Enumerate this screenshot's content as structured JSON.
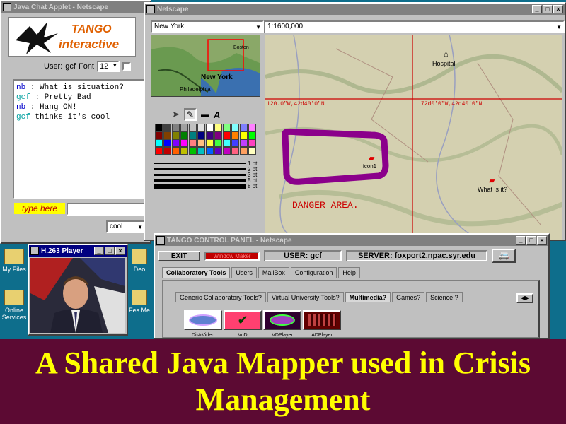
{
  "chat": {
    "title": "Java Chat Applet - Netscape",
    "logo_line1": "TANGO",
    "logo_line2": "interactive",
    "user_label": "User:",
    "user_value": "gcf",
    "font_label": "Font",
    "font_value": "12",
    "messages": [
      {
        "user": "nb",
        "text": ": What is situation?",
        "color": "#0000cc"
      },
      {
        "user": "gcf",
        "text": ": Pretty Bad",
        "color": "#00a0a0"
      },
      {
        "user": "nb",
        "text": ": Hang ON!",
        "color": "#0000cc"
      },
      {
        "user": "gcf",
        "text": "thinks it's cool",
        "color": "#00a0a0"
      }
    ],
    "type_here_label": "type here",
    "mood_value": "cool"
  },
  "netscape": {
    "title": "Netscape",
    "location_value": "New York",
    "scale_value": "1:1600,000",
    "minimap_label": "New York",
    "minimap_label2": "Philadelphia",
    "minimap_label3": "Boston",
    "palette_colors": [
      "#000000",
      "#404040",
      "#808080",
      "#a0a0a0",
      "#c0c0c0",
      "#e0e0e0",
      "#ffffff",
      "#ffff80",
      "#80ff80",
      "#80ffff",
      "#8080ff",
      "#ff80ff",
      "#800000",
      "#804000",
      "#808000",
      "#008000",
      "#008080",
      "#000080",
      "#400080",
      "#800080",
      "#ff0000",
      "#ff8000",
      "#ffff00",
      "#00ff00",
      "#00ffff",
      "#0000ff",
      "#8000ff",
      "#ff00ff",
      "#ff8080",
      "#ffc080",
      "#ffff40",
      "#40ff40",
      "#40ffff",
      "#4040ff",
      "#c040ff",
      "#ff40c0",
      "#ff0000",
      "#c00000",
      "#ff6000",
      "#c0c000",
      "#00c000",
      "#00c0c0",
      "#0060ff",
      "#6000c0",
      "#c000c0",
      "#ff6080",
      "#ffa060",
      "#ffffc0"
    ],
    "line_widths": [
      "1 pt",
      "2 pt",
      "3 pt",
      "5 pt",
      "8 pt"
    ],
    "coord_left": "120.0\"W,42d40'0\"N",
    "coord_right": "72d0'0\"W,42d40'0\"N",
    "hospital_label": "Hospital",
    "car_label": "icon1",
    "unknown_label": "What is it?",
    "danger_label": "DANGER AREA."
  },
  "h263": {
    "title": "H.263 Player"
  },
  "desktop_icons": [
    {
      "label": "My Files"
    },
    {
      "label": "Online Services"
    },
    {
      "label": "Deo"
    },
    {
      "label": "Fes Me"
    }
  ],
  "control_panel": {
    "title": "TANGO CONTROL PANEL - Netscape",
    "exit_label": "EXIT",
    "status_label": "Window Maker",
    "user_text": "USER: gcf",
    "server_text": "SERVER: foxport2.npac.syr.edu",
    "top_tabs": [
      "Collaboratory Tools",
      "Users",
      "MailBox",
      "Configuration",
      "Help"
    ],
    "sub_tabs": [
      "Generic Collaboratory Tools?",
      "Virtual University Tools?",
      "Multimedia?",
      "Games?",
      "Science ?"
    ],
    "apps": [
      {
        "label": "DistrVideo",
        "color": "#d0d0ff"
      },
      {
        "label": "VoD",
        "color": "#ff6080"
      },
      {
        "label": "VDPlayer",
        "color": "#800080"
      },
      {
        "label": "ADPlayer",
        "color": "#800000"
      }
    ]
  },
  "caption": {
    "line1": "A Shared Java Mapper used in Crisis",
    "line2": "Management"
  },
  "colors": {
    "caption_bg": "#5c0a33",
    "caption_text": "#ffff00",
    "danger_zone": "#8b008b",
    "grid_line": "#cc0000"
  }
}
